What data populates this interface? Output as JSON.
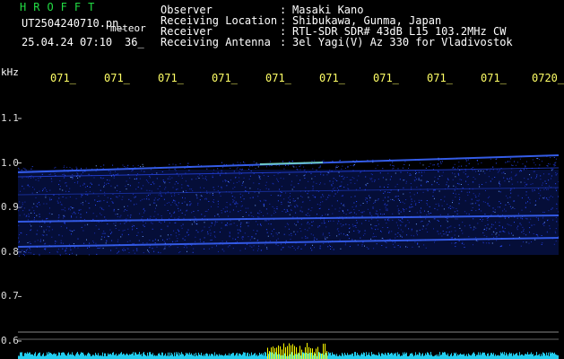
{
  "header": {
    "app_title": "HROFFT",
    "file_name": "UT2504240710.pn_",
    "meteor_label": "meteor",
    "datetime": "25.04.24 07:10",
    "count": "36_"
  },
  "station_info": [
    {
      "label": "Observer",
      "value": "Masaki Kano"
    },
    {
      "label": "Receiving Location",
      "value": "Shibukawa, Gunma, Japan"
    },
    {
      "label": "Receiver",
      "value": "RTL-SDR SDR# 43dB L15 103.2MHz CW"
    },
    {
      "label": "Receiving Antenna",
      "value": "3el Yagi(V) Az 330 for Vladivostok"
    }
  ],
  "separator": ":",
  "axis": {
    "unit": "kHz",
    "x_ticks": [
      "071_",
      "071_",
      "071_",
      "071_",
      "071_",
      "071_",
      "071_",
      "071_",
      "071_",
      "0720_"
    ],
    "y_ticks": [
      "1.1",
      "1.0",
      "0.9",
      "0.8",
      "0.7",
      "0.6"
    ]
  },
  "colors": {
    "background": "#000000",
    "title_green": "#22dd44",
    "tick_yellow": "#ffff66",
    "signal_blue": "#2a4cff",
    "level_cyan": "#22ccee",
    "level_yellow": "#ffff00"
  }
}
